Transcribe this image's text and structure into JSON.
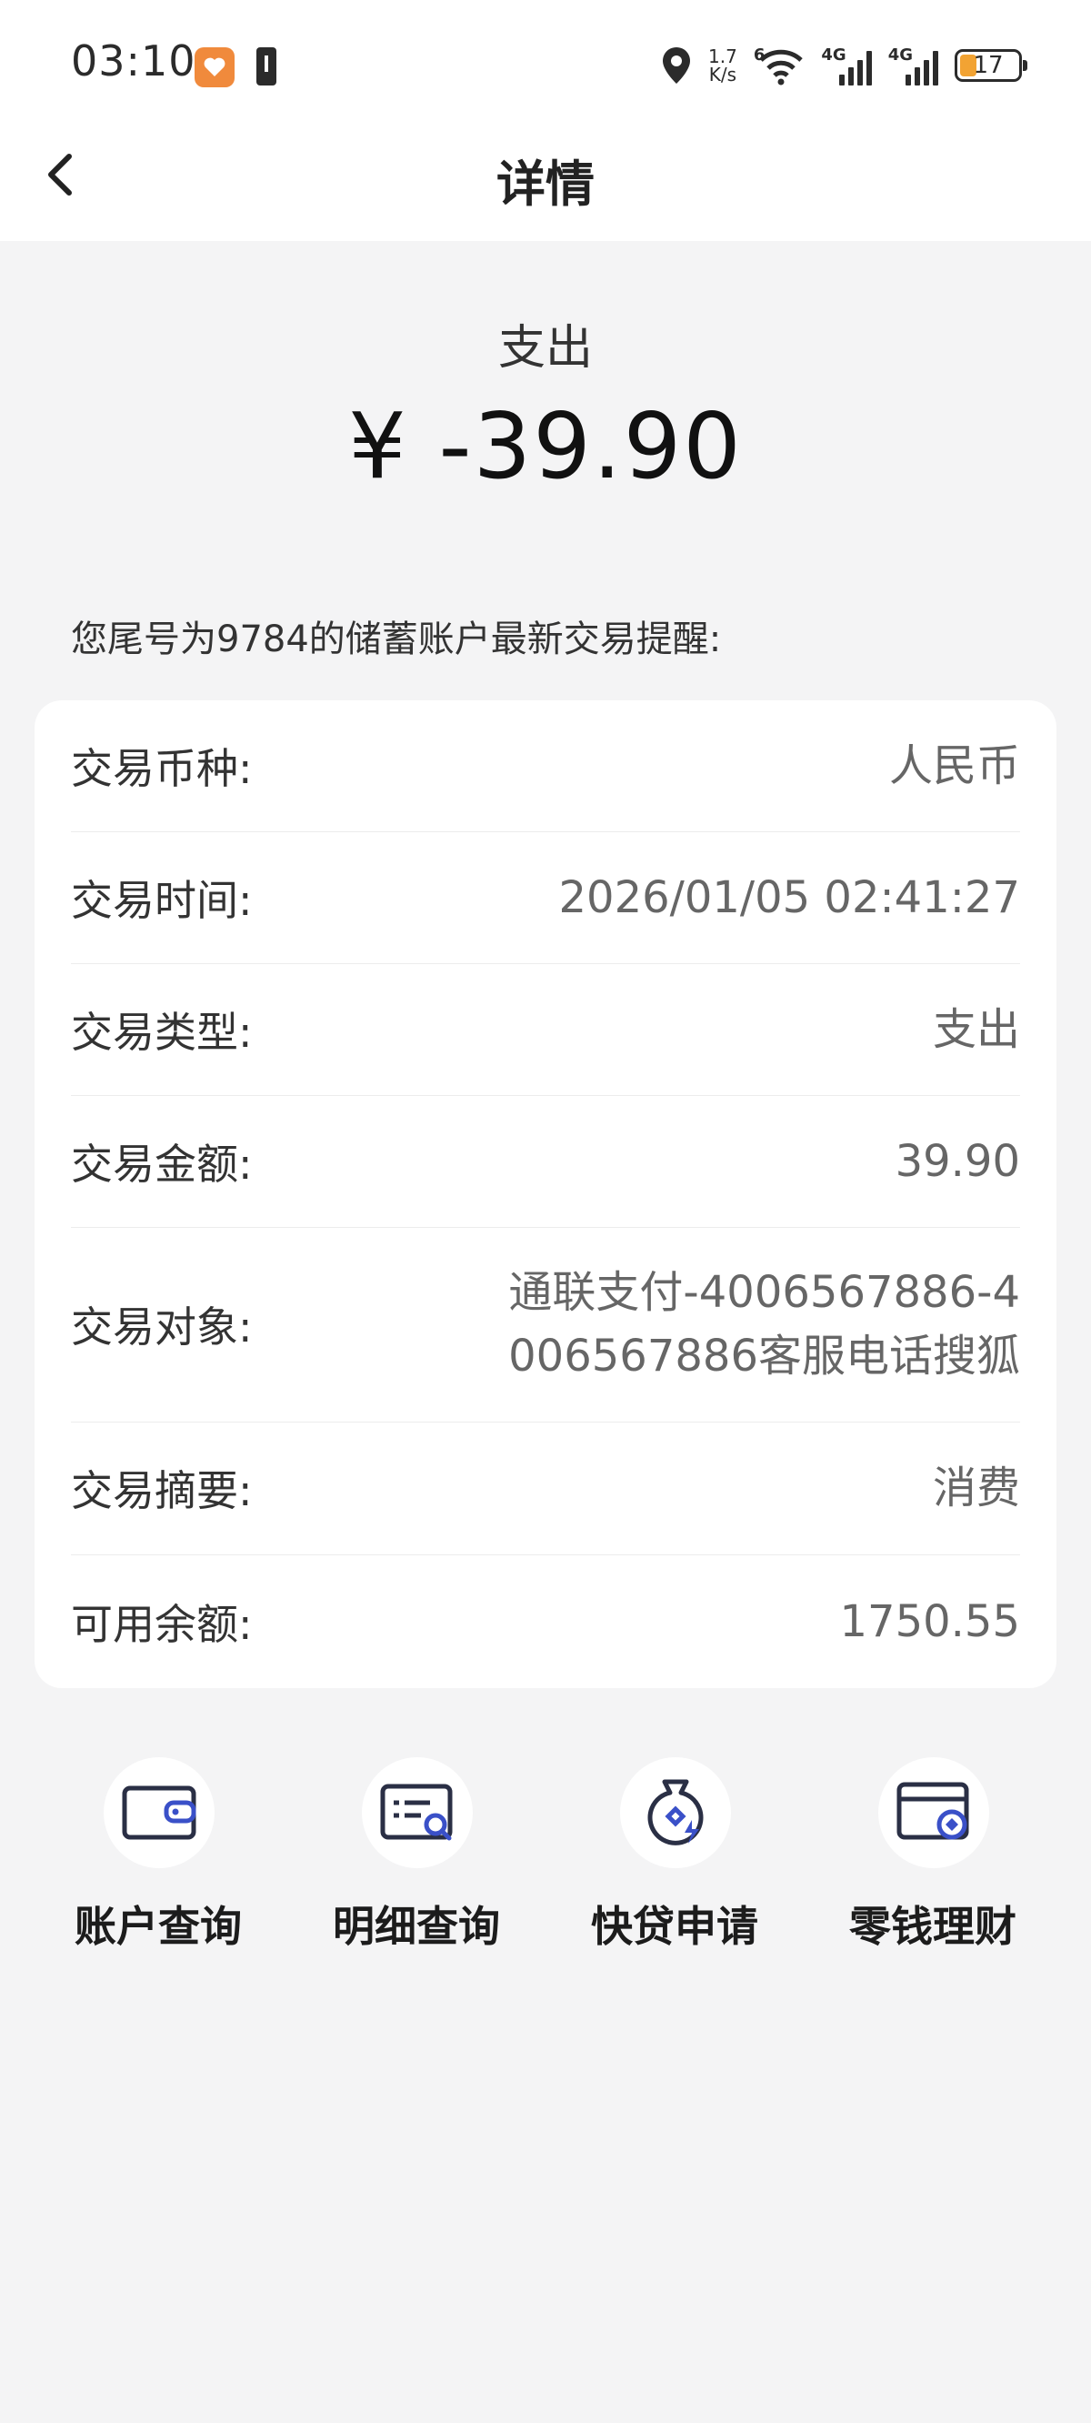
{
  "status_bar": {
    "time": "03:10",
    "net_speed_value": "1.7",
    "net_speed_unit": "K/s",
    "wifi_badge": "6",
    "sim1_label": "4G",
    "sim2_label": "4G",
    "battery_level": "17"
  },
  "header": {
    "title": "详情"
  },
  "summary": {
    "type": "支出",
    "amount": "¥ -39.90"
  },
  "reminder_text": "您尾号为9784的储蓄账户最新交易提醒:",
  "details": {
    "currency": {
      "label": "交易币种:",
      "value": "人民币"
    },
    "time": {
      "label": "交易时间:",
      "value": "2026/01/05 02:41:27"
    },
    "type": {
      "label": "交易类型:",
      "value": "支出"
    },
    "amount": {
      "label": "交易金额:",
      "value": "39.90"
    },
    "counterparty": {
      "label": "交易对象:",
      "value_line1": "通联支付-4006567886-4",
      "value_line2": "006567886客服电话搜狐"
    },
    "summary": {
      "label": "交易摘要:",
      "value": "消费"
    },
    "balance": {
      "label": "可用余额:",
      "value": "1750.55"
    }
  },
  "actions": [
    {
      "label": "账户查询",
      "icon": "wallet-icon"
    },
    {
      "label": "明细查询",
      "icon": "list-search-icon"
    },
    {
      "label": "快贷申请",
      "icon": "quick-loan-icon"
    },
    {
      "label": "零钱理财",
      "icon": "card-coin-icon"
    }
  ],
  "colors": {
    "accent": "#3a50c8",
    "background": "#f4f4f5"
  }
}
